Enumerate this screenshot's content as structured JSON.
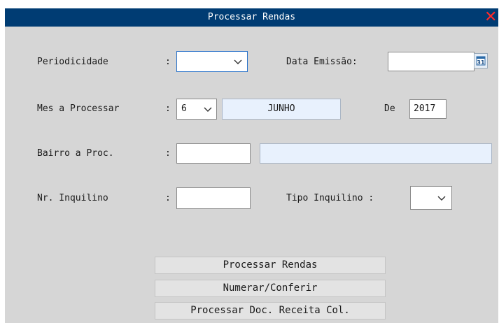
{
  "window": {
    "title": "Processar Rendas"
  },
  "form": {
    "periodicidade": {
      "label": "Periodicidade",
      "colon": ":",
      "value": ""
    },
    "data_emissao": {
      "label": "Data Emissão:",
      "value": ""
    },
    "mes": {
      "label": "Mes a Processar",
      "colon": ":",
      "value": "6",
      "month_name": "JUNHO"
    },
    "ano": {
      "label": "De",
      "value": "2017"
    },
    "bairro": {
      "label": "Bairro a Proc.",
      "colon": ":",
      "code": "",
      "name": ""
    },
    "inquilino": {
      "label": "Nr. Inquilino",
      "colon": ":",
      "value": ""
    },
    "tipo_inquilino": {
      "label": "Tipo Inquilino :",
      "value": ""
    }
  },
  "buttons": {
    "processar": "Processar Rendas",
    "numerar": "Numerar/Conferir",
    "doc_receita": "Processar Doc. Receita Col."
  },
  "icons": {
    "close": "close-icon",
    "calendar": "calendar-icon",
    "dropdown": "chevron-down-icon"
  },
  "colors": {
    "titlebar": "#003c73",
    "window_bg": "#d6d6d6",
    "readonly_field": "#e8f1fd",
    "close": "#ff2a2a"
  }
}
